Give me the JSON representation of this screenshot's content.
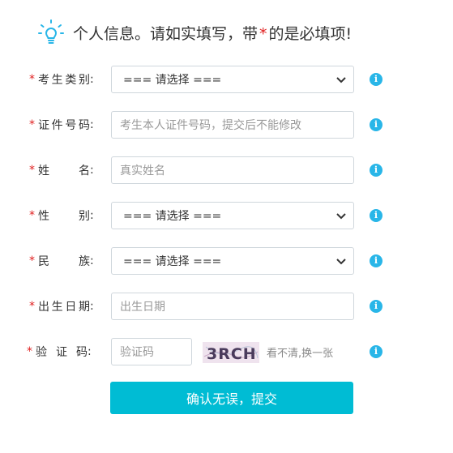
{
  "header": {
    "text_before": "个人信息。请如实填写，带",
    "star": "*",
    "text_after": "的是必填项!"
  },
  "form": {
    "required_mark": "*",
    "colon": ":",
    "exam_type": {
      "label_chars": [
        "考",
        "生",
        "类",
        "别"
      ],
      "value": "=== 请选择 ==="
    },
    "id_number": {
      "label_chars": [
        "证",
        "件",
        "号",
        "码"
      ],
      "placeholder": "考生本人证件号码，提交后不能修改"
    },
    "name": {
      "label_chars": [
        "姓",
        "名"
      ],
      "placeholder": "真实姓名"
    },
    "gender": {
      "label_chars": [
        "性",
        "别"
      ],
      "value": "=== 请选择 ==="
    },
    "ethnicity": {
      "label_chars": [
        "民",
        "族"
      ],
      "value": "=== 请选择 ==="
    },
    "birth_date": {
      "label_chars": [
        "出",
        "生",
        "日",
        "期"
      ],
      "placeholder": "出生日期"
    },
    "captcha": {
      "label_chars": [
        "验",
        "证",
        "码"
      ],
      "placeholder": "验证码",
      "image_text": "3RCH",
      "refresh_text": "看不清,换一张"
    },
    "info_icon_glyph": "i",
    "submit_label": "确认无误，提交"
  },
  "colors": {
    "accent": "#00bcd4",
    "info": "#29b6e8",
    "required": "#e02020",
    "border": "#cfd6dc"
  },
  "icons": {
    "header": "lightbulb-icon",
    "info": "info-icon",
    "dropdown": "chevron-down-icon"
  }
}
